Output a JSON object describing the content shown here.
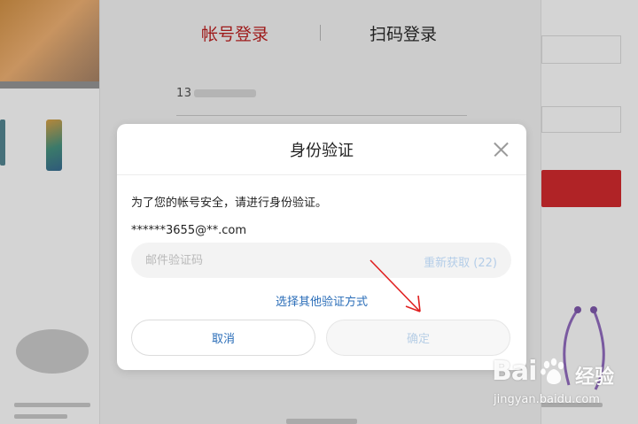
{
  "login_panel": {
    "tab_account": "帐号登录",
    "tab_qr": "扫码登录",
    "phone_value": "13"
  },
  "dialog": {
    "title": "身份验证",
    "notice": "为了您的帐号安全，请进行身份验证。",
    "email": "******3655@**.com",
    "code_placeholder": "邮件验证码",
    "resend_label": "重新获取 (22)",
    "other_method_label": "选择其他验证方式",
    "cancel_label": "取消",
    "confirm_label": "确定"
  },
  "watermark": {
    "logo_text": "Bai",
    "logo_text2": "经验",
    "url": "jingyan.baidu.com"
  },
  "colors": {
    "accent_red": "#9e1a1a",
    "link_blue": "#2a6db8",
    "annotation_red": "#e02020"
  }
}
